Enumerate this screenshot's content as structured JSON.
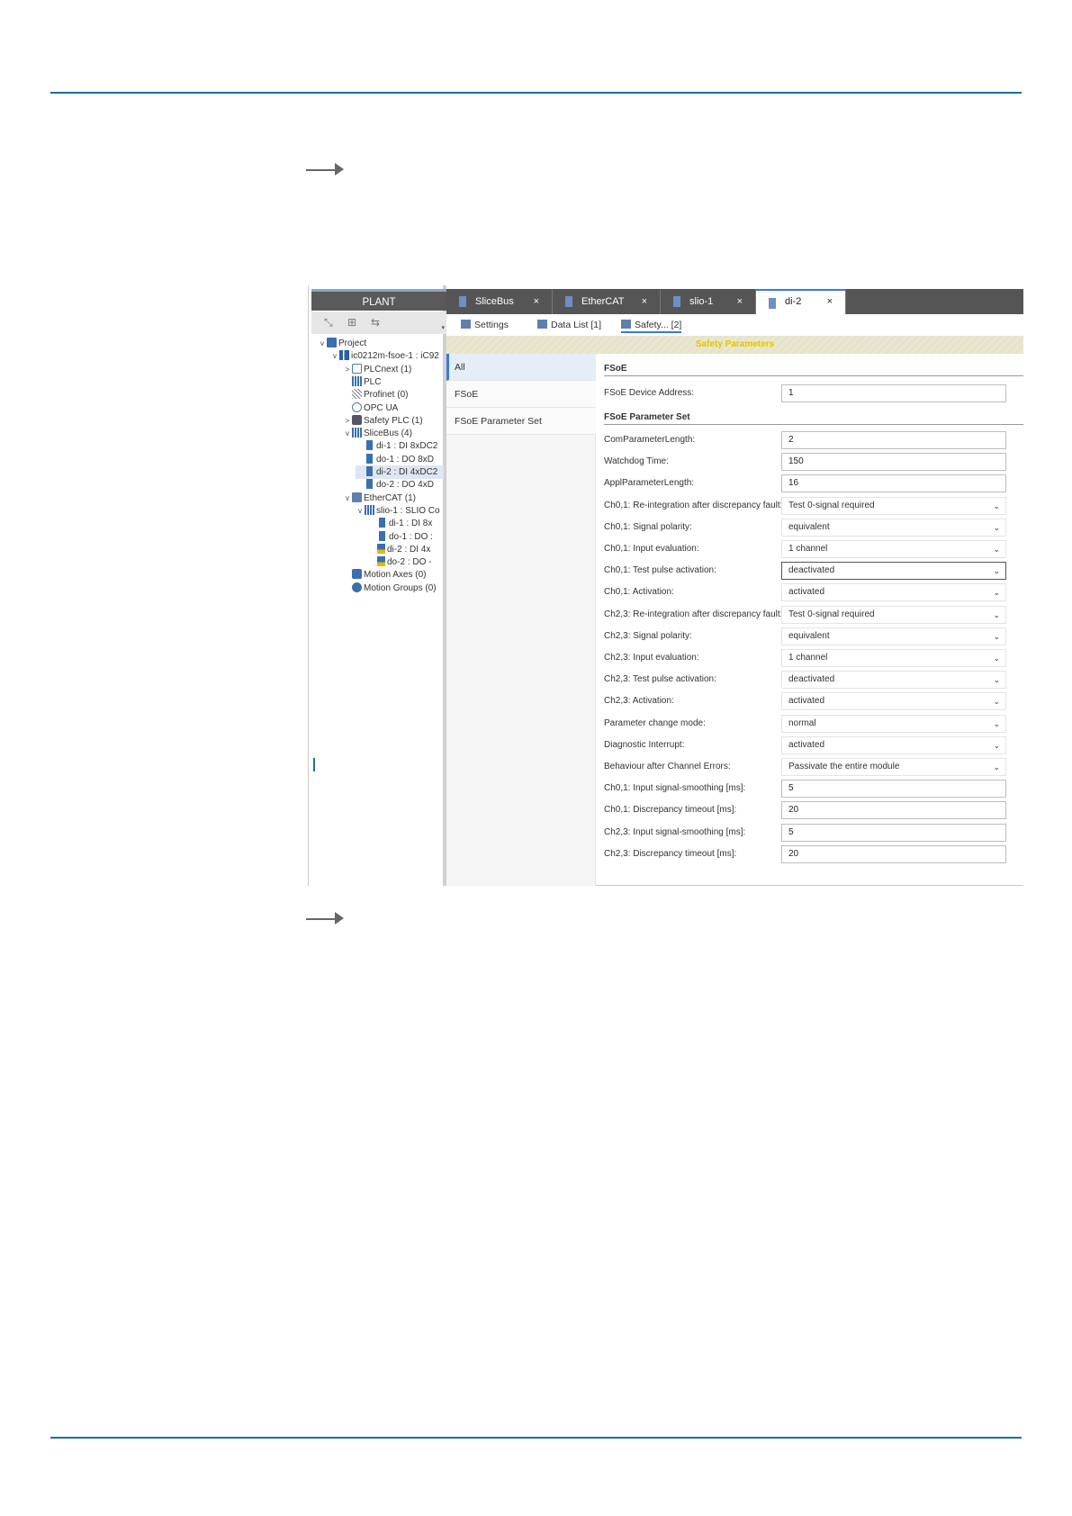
{
  "plant": {
    "title": "PLANT",
    "toolbar": {
      "expand_icon": "expand-icon",
      "collapse_icon": "collapse-icon",
      "sync_icon": "sync-icon",
      "caret": "▾"
    },
    "tree": [
      {
        "label": "Project",
        "depth": 0,
        "toggle": "v",
        "icon": "folder"
      },
      {
        "label": "ic0212m-fsoe-1 : iC92",
        "depth": 1,
        "toggle": "v",
        "icon": "dev"
      },
      {
        "label": "PLCnext (1)",
        "depth": 2,
        "toggle": ">",
        "icon": "plc"
      },
      {
        "label": "PLC",
        "depth": 2,
        "toggle": "",
        "icon": "grid"
      },
      {
        "label": "Profinet (0)",
        "depth": 2,
        "toggle": "",
        "icon": "net"
      },
      {
        "label": "OPC UA",
        "depth": 2,
        "toggle": "",
        "icon": "opc"
      },
      {
        "label": "Safety PLC (1)",
        "depth": 2,
        "toggle": ">",
        "icon": "safety"
      },
      {
        "label": "SliceBus (4)",
        "depth": 2,
        "toggle": "v",
        "icon": "grid"
      },
      {
        "label": "di-1 : DI 8xDC2",
        "depth": 3,
        "toggle": "",
        "icon": "mod"
      },
      {
        "label": "do-1 : DO 8xD",
        "depth": 3,
        "toggle": "",
        "icon": "mod"
      },
      {
        "label": "di-2 : DI 4xDC2",
        "depth": 3,
        "toggle": "",
        "icon": "mod",
        "selected": true
      },
      {
        "label": "do-2 : DO 4xD",
        "depth": 3,
        "toggle": "",
        "icon": "mod"
      },
      {
        "label": "EtherCAT (1)",
        "depth": 2,
        "toggle": "v",
        "icon": "eth"
      },
      {
        "label": "slio-1 : SLIO Co",
        "depth": 3,
        "toggle": "v",
        "icon": "grid"
      },
      {
        "label": "di-1 : DI 8x",
        "depth": 4,
        "toggle": "",
        "icon": "mod"
      },
      {
        "label": "do-1 : DO :",
        "depth": 4,
        "toggle": "",
        "icon": "mod"
      },
      {
        "label": "di-2 : DI 4x",
        "depth": 4,
        "toggle": "",
        "icon": "mod-y"
      },
      {
        "label": "do-2 : DO -",
        "depth": 4,
        "toggle": "",
        "icon": "mod-y"
      },
      {
        "label": "Motion Axes (0)",
        "depth": 2,
        "toggle": "",
        "icon": "axis"
      },
      {
        "label": "Motion Groups (0)",
        "depth": 2,
        "toggle": "",
        "icon": "grp"
      }
    ]
  },
  "tabs": [
    {
      "label": "SliceBus",
      "close": "×"
    },
    {
      "label": "EtherCAT",
      "close": "×"
    },
    {
      "label": "slio-1",
      "close": "×"
    },
    {
      "label": "di-2",
      "close": "×",
      "active": true
    }
  ],
  "subtabs": [
    {
      "label": "Settings"
    },
    {
      "label": "Data List  [1]"
    },
    {
      "label": "Safety...  [2]",
      "active": true
    }
  ],
  "header_band": "Safety Parameters",
  "categories": [
    {
      "label": "All",
      "active": true
    },
    {
      "label": "FSoE"
    },
    {
      "label": "FSoE Parameter Set"
    }
  ],
  "sections": {
    "fsoe": "FSoE",
    "param_set": "FSoE Parameter Set"
  },
  "chevron": "⌄",
  "params": {
    "fsoe_address": {
      "label": "FSoE Device Address:",
      "value": "1"
    },
    "list": [
      {
        "label": "ComParameterLength:",
        "value": "2",
        "kind": "input"
      },
      {
        "label": "Watchdog Time:",
        "value": "150",
        "kind": "input"
      },
      {
        "label": "ApplParameterLength:",
        "value": "16",
        "kind": "input"
      },
      {
        "label": "Ch0,1: Re-integration after discrepancy fault:",
        "value": "Test 0-signal required",
        "kind": "select"
      },
      {
        "label": "Ch0,1: Signal polarity:",
        "value": "equivalent",
        "kind": "select"
      },
      {
        "label": "Ch0,1: Input evaluation:",
        "value": "1 channel",
        "kind": "select"
      },
      {
        "label": "Ch0,1: Test pulse activation:",
        "value": "deactivated",
        "kind": "select",
        "focus": true
      },
      {
        "label": "Ch0,1: Activation:",
        "value": "activated",
        "kind": "select"
      },
      {
        "label": "Ch2,3: Re-integration after discrepancy fault:",
        "value": "Test 0-signal required",
        "kind": "select"
      },
      {
        "label": "Ch2,3: Signal polarity:",
        "value": "equivalent",
        "kind": "select"
      },
      {
        "label": "Ch2,3: Input evaluation:",
        "value": "1 channel",
        "kind": "select"
      },
      {
        "label": "Ch2,3: Test pulse activation:",
        "value": "deactivated",
        "kind": "select"
      },
      {
        "label": "Ch2,3: Activation:",
        "value": "activated",
        "kind": "select"
      },
      {
        "label": "Parameter change mode:",
        "value": "normal",
        "kind": "select"
      },
      {
        "label": "Diagnostic Interrupt:",
        "value": "activated",
        "kind": "select"
      },
      {
        "label": "Behaviour after Channel Errors:",
        "value": "Passivate the entire module",
        "kind": "select"
      },
      {
        "label": "Ch0,1: Input signal-smoothing [ms]:",
        "value": "5",
        "kind": "input"
      },
      {
        "label": "Ch0,1: Discrepancy timeout [ms]:",
        "value": "20",
        "kind": "input"
      },
      {
        "label": "Ch2,3: Input signal-smoothing [ms]:",
        "value": "5",
        "kind": "input"
      },
      {
        "label": "Ch2,3: Discrepancy timeout [ms]:",
        "value": "20",
        "kind": "input"
      }
    ]
  },
  "colors": {
    "accent": "#3a7bd5",
    "rule": "#1f6e9e",
    "header_text": "#e6c400"
  }
}
